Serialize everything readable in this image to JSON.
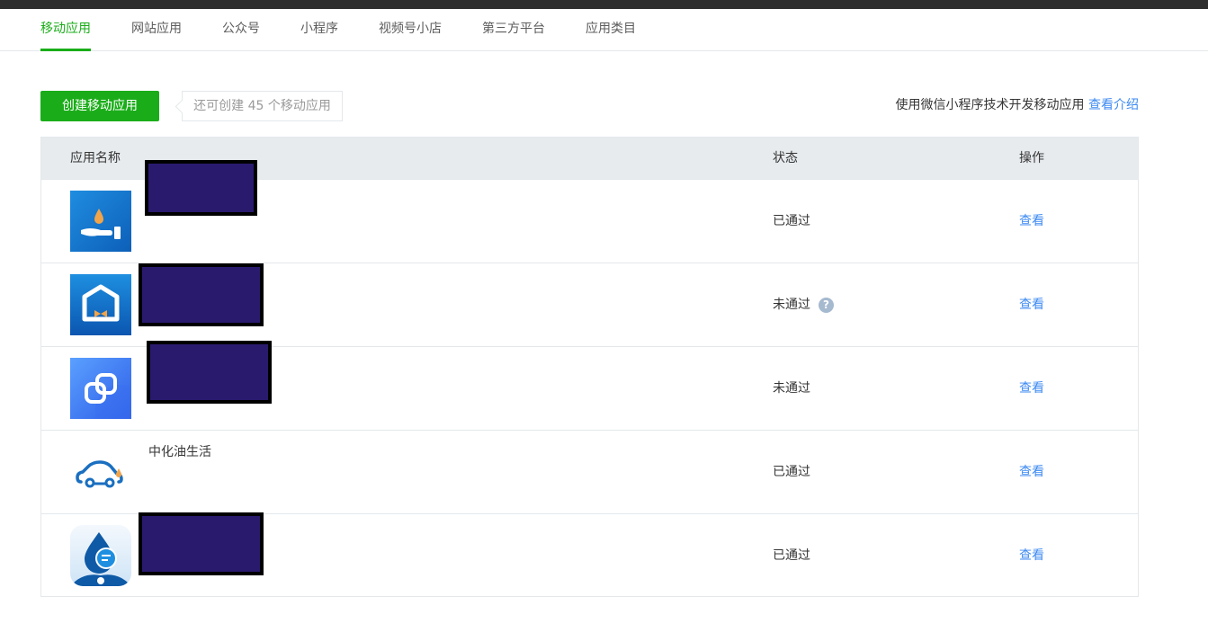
{
  "tabs": [
    "移动应用",
    "网站应用",
    "公众号",
    "小程序",
    "视频号小店",
    "第三方平台",
    "应用类目"
  ],
  "toolbar": {
    "create_label": "创建移动应用",
    "quota_text": "还可创建 45 个移动应用",
    "intro_text": "使用微信小程序技术开发移动应用",
    "intro_link": "查看介绍"
  },
  "table": {
    "headers": {
      "name": "应用名称",
      "status": "状态",
      "action": "操作"
    },
    "rows": [
      {
        "name": "",
        "status": "已通过",
        "action": "查看",
        "icon": "hand-water-drop-icon",
        "has_help": false
      },
      {
        "name": "",
        "status": "未通过",
        "action": "查看",
        "icon": "house-bowtie-icon",
        "has_help": true
      },
      {
        "name": "",
        "status": "未通过",
        "action": "查看",
        "icon": "overlap-squares-icon",
        "has_help": false
      },
      {
        "name": "中化油生活",
        "status": "已通过",
        "action": "查看",
        "icon": "car-drop-icon",
        "has_help": false
      },
      {
        "name": "",
        "status": "已通过",
        "action": "查看",
        "icon": "drop-chat-icon",
        "has_help": false
      }
    ]
  },
  "colors": {
    "accent": "#1aad19",
    "link": "#3d8af2",
    "header_bg": "#e7ebee",
    "redaction": "#2a1a6e"
  }
}
